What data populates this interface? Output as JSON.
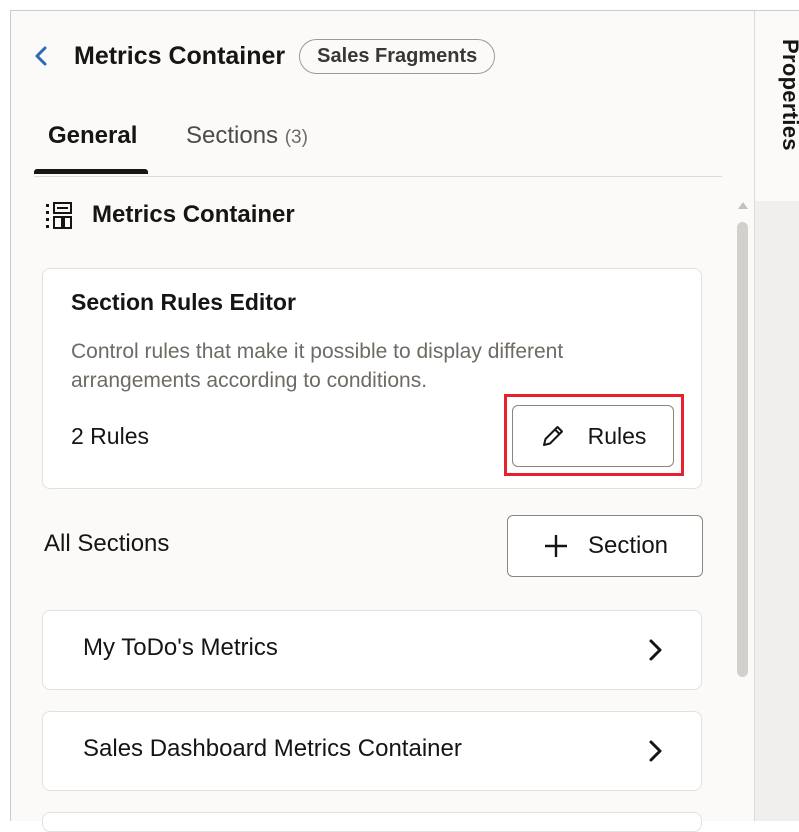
{
  "header": {
    "title": "Metrics Container",
    "badge": "Sales Fragments",
    "back_icon": "chevron-left-icon"
  },
  "tabs": [
    {
      "label": "General",
      "selected": true
    },
    {
      "label": "Sections",
      "count": "(3)",
      "selected": false
    }
  ],
  "side_rail": {
    "tab_label": "Properties"
  },
  "section_heading": {
    "icon": "container-icon",
    "label": "Metrics Container"
  },
  "rules_card": {
    "title": "Section Rules Editor",
    "description": "Control rules that make it possible to display different arrangements according to conditions.",
    "rules_count": "2 Rules",
    "button_label": "Rules",
    "button_icon": "pencil-icon",
    "highlight_color": "#e6212e"
  },
  "all_sections": {
    "label": "All Sections",
    "add_button_label": "Section",
    "add_button_icon": "plus-icon",
    "items": [
      {
        "label": "My ToDo's Metrics"
      },
      {
        "label": "Sales Dashboard Metrics Container"
      }
    ]
  },
  "colors": {
    "text": "#161513",
    "muted_text": "#6f6a64",
    "accent_blue": "#2b6ab0",
    "panel_bg": "#fbfaf9"
  }
}
